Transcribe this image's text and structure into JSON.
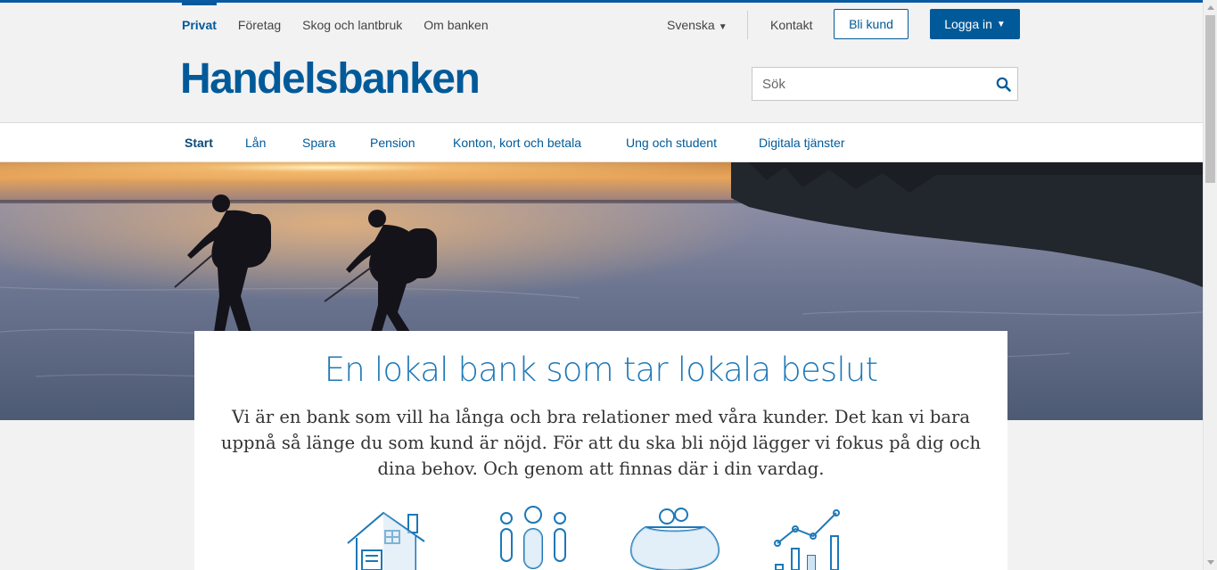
{
  "segment_nav": [
    {
      "label": "Privat",
      "active": true
    },
    {
      "label": "Företag"
    },
    {
      "label": "Skog och lantbruk"
    },
    {
      "label": "Om banken"
    }
  ],
  "utility": {
    "language": "Svenska",
    "contact": "Kontakt",
    "become_customer": "Bli kund",
    "login": "Logga in"
  },
  "logo": "Handelsbanken",
  "search": {
    "placeholder": "Sök",
    "icon": "search-icon"
  },
  "main_nav": [
    {
      "label": "Start",
      "active": true
    },
    {
      "label": "Lån"
    },
    {
      "label": "Spara"
    },
    {
      "label": "Pension"
    },
    {
      "label": "Konton, kort och betala"
    },
    {
      "label": "Ung och student"
    },
    {
      "label": "Digitala tjänster"
    }
  ],
  "hero": {
    "image": "skaters-on-ice-at-sunset"
  },
  "intro": {
    "title": "En lokal bank som tar lokala beslut",
    "text": "Vi är en bank som vill ha långa och bra relationer med våra kunder. Det kan vi bara uppnå så länge du som kund är nöjd. För att du ska bli nöjd lägger vi fokus på dig och dina behov. Och genom att finnas där i din vardag."
  },
  "feature_icons": [
    "house-icon",
    "people-icon",
    "savings-purse-icon",
    "growth-chart-icon"
  ],
  "colors": {
    "brand": "#005a99",
    "accent": "#1c78b8"
  }
}
